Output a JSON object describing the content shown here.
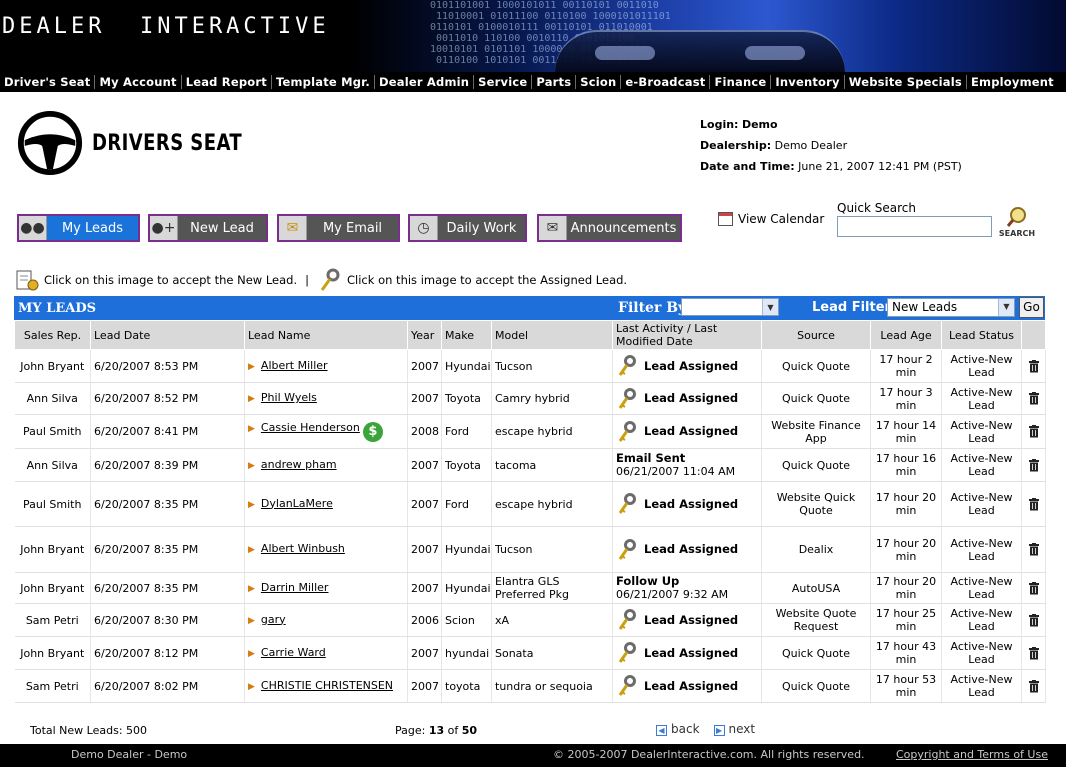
{
  "header": {
    "brand": "DEALER  INTERACTIVE",
    "nav": [
      "Driver's Seat",
      "My Account",
      "Lead Report",
      "Template Mgr.",
      "Dealer Admin",
      "Service",
      "Parts",
      "Scion",
      "e-Broadcast",
      "Finance",
      "Inventory",
      "Website Specials",
      "Employment"
    ]
  },
  "logo": {
    "text": "DRIVERS SEAT"
  },
  "login": {
    "login_label": "Login:",
    "login_value": "Demo",
    "dealership_label": "Dealership:",
    "dealership_value": "Demo Dealer",
    "datetime_label": "Date and Time:",
    "datetime_value": "June 21, 2007 12:41 PM (PST)"
  },
  "actions": [
    {
      "label": "My Leads",
      "icon": "people-icon",
      "active": true
    },
    {
      "label": "New Lead",
      "icon": "add-person-icon",
      "active": false
    },
    {
      "label": "My Email",
      "icon": "envelope-icon",
      "active": false
    },
    {
      "label": "Daily Work",
      "icon": "clock-icon",
      "active": false
    },
    {
      "label": "Announcements",
      "icon": "megaphone-icon",
      "active": false
    }
  ],
  "calendar": {
    "label": "View Calendar"
  },
  "quick_search": {
    "label": "Quick Search",
    "value": "",
    "button": "SEARCH"
  },
  "legend": {
    "new_lead": "Click on this image to accept the New Lead.",
    "separator": "|",
    "assigned_lead": "Click on this image to accept the Assigned Lead."
  },
  "leads": {
    "title": "MY LEADS",
    "filter_by_label": "Filter By",
    "filter_by_value": "",
    "lead_filter_label": "Lead Filter",
    "lead_filter_value": "New Leads",
    "go": "Go",
    "columns": [
      "Sales Rep.",
      "Lead Date",
      "Lead Name",
      "Year",
      "Make",
      "Model",
      "Last Activity / Last Modified Date",
      "Source",
      "Lead Age",
      "Lead Status"
    ],
    "rows": [
      {
        "rep": "John Bryant",
        "date": "6/20/2007 8:53 PM",
        "name": "Albert  Miller",
        "year": "2007",
        "make": "Hyundai",
        "model": "Tucson",
        "activity": "Lead Assigned",
        "activity_date": "",
        "source": "Quick Quote",
        "age": "17 hour 2 min",
        "status": "Active-New Lead",
        "dollar": false
      },
      {
        "rep": "Ann Silva",
        "date": "6/20/2007 8:52 PM",
        "name": "Phil Wyels",
        "year": "2007",
        "make": "Toyota",
        "model": "Camry hybrid",
        "activity": "Lead Assigned",
        "activity_date": "",
        "source": "Quick Quote",
        "age": "17 hour 3 min",
        "status": "Active-New Lead",
        "dollar": false
      },
      {
        "rep": "Paul Smith",
        "date": "6/20/2007 8:41 PM",
        "name": "Cassie Henderson",
        "year": "2008",
        "make": "Ford",
        "model": "escape hybrid",
        "activity": "Lead Assigned",
        "activity_date": "",
        "source": "Website Finance App",
        "age": "17 hour 14 min",
        "status": "Active-New Lead",
        "dollar": true
      },
      {
        "rep": "Ann Silva",
        "date": "6/20/2007 8:39 PM",
        "name": "andrew pham",
        "year": "2007",
        "make": "Toyota",
        "model": "tacoma",
        "activity": "Email Sent",
        "activity_date": "06/21/2007 11:04 AM",
        "source": "Quick Quote",
        "age": "17 hour 16 min",
        "status": "Active-New Lead",
        "dollar": false
      },
      {
        "rep": "Paul Smith",
        "date": "6/20/2007 8:35 PM",
        "name": "DylanLaMere",
        "year": "2007",
        "make": "Ford",
        "model": "escape hybrid",
        "activity": "Lead Assigned",
        "activity_date": "",
        "source": "Website Quick Quote",
        "age": "17 hour 20 min",
        "status": "Active-New Lead",
        "dollar": false
      },
      {
        "rep": "John Bryant",
        "date": "6/20/2007 8:35 PM",
        "name": "Albert Winbush",
        "year": "2007",
        "make": "Hyundai",
        "model": "Tucson",
        "activity": "Lead Assigned",
        "activity_date": "",
        "source": "Dealix",
        "age": "17 hour 20 min",
        "status": "Active-New Lead",
        "dollar": false
      },
      {
        "rep": "John Bryant",
        "date": "6/20/2007 8:35 PM",
        "name": "Darrin Miller",
        "year": "2007",
        "make": "Hyundai",
        "model": "Elantra GLS Preferred Pkg",
        "activity": "Follow Up",
        "activity_date": "06/21/2007 9:32 AM",
        "source": "AutoUSA",
        "age": "17 hour 20 min",
        "status": "Active-New Lead",
        "dollar": false
      },
      {
        "rep": "Sam Petri",
        "date": "6/20/2007 8:30 PM",
        "name": "gary",
        "year": "2006",
        "make": "Scion",
        "model": "xA",
        "activity": "Lead Assigned",
        "activity_date": "",
        "source": "Website Quote Request",
        "age": "17 hour 25 min",
        "status": "Active-New Lead",
        "dollar": false
      },
      {
        "rep": "John Bryant",
        "date": "6/20/2007 8:12 PM",
        "name": "Carrie Ward",
        "year": "2007",
        "make": "hyundai",
        "model": "Sonata",
        "activity": "Lead Assigned",
        "activity_date": "",
        "source": "Quick Quote",
        "age": "17 hour 43 min",
        "status": "Active-New Lead",
        "dollar": false
      },
      {
        "rep": "Sam Petri",
        "date": "6/20/2007 8:02 PM",
        "name": "CHRISTIE CHRISTENSEN",
        "year": "2007",
        "make": "toyota",
        "model": "tundra or sequoia",
        "activity": "Lead Assigned",
        "activity_date": "",
        "source": "Quick Quote",
        "age": "17 hour 53 min",
        "status": "Active-New Lead",
        "dollar": false
      }
    ]
  },
  "footer": {
    "total_label": "Total New Leads:",
    "total_value": "500",
    "page_label": "Page:",
    "page_current": "13",
    "page_of": "of",
    "page_total": "50",
    "back": "back",
    "next": "next",
    "dealer": "Demo Dealer - Demo",
    "copyright": "© 2005-2007 DealerInteractive.com. All rights reserved.",
    "terms": "Copyright and Terms of Use"
  }
}
